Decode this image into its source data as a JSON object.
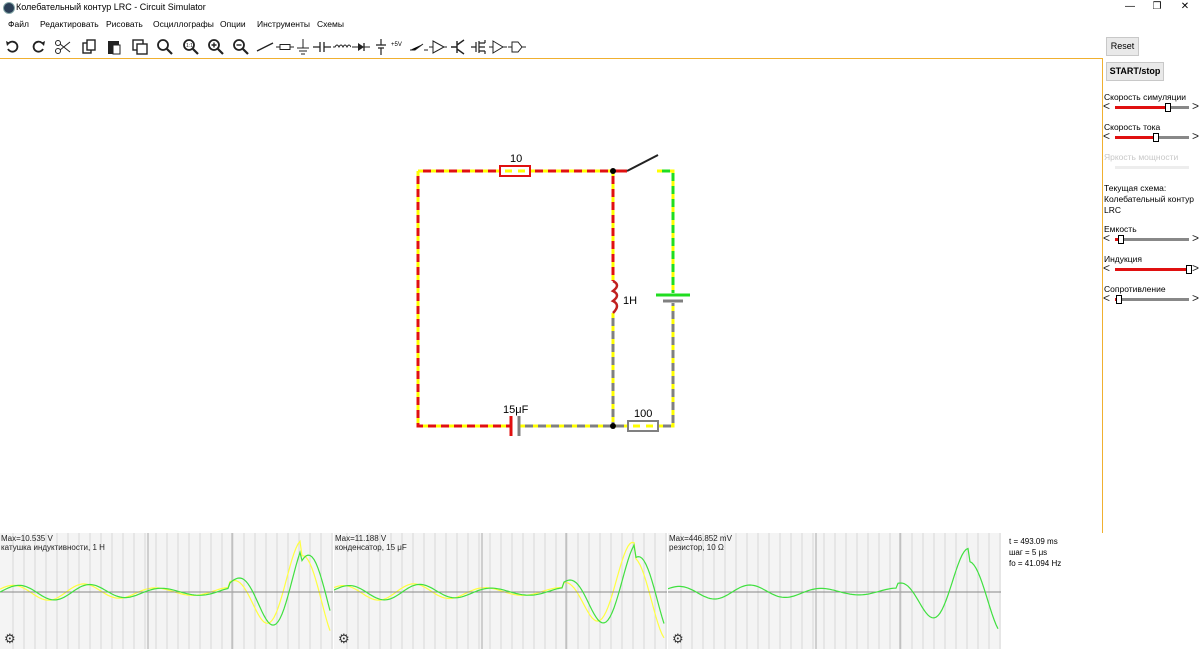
{
  "window": {
    "title": "Колебательный контур LRC - Circuit Simulator",
    "controls": [
      "—",
      "❐",
      "✕"
    ]
  },
  "menu": [
    "Файл",
    "Редактировать",
    "Рисовать",
    "Осциллографы",
    "Опции",
    "Инструменты",
    "Схемы"
  ],
  "toolbar": {
    "tools": [
      "undo-icon",
      "redo-icon",
      "cut-icon",
      "copy-icon",
      "paste-icon",
      "duplicate-icon",
      "zoom-search-icon",
      "zoom-fit-icon",
      "zoom-in-icon",
      "zoom-out-icon",
      "wire-icon",
      "resistor-icon",
      "ground-icon",
      "capacitor-icon",
      "inductor-icon",
      "diode-icon",
      "battery-icon",
      "voltage-5v-icon",
      "switch-icon",
      "opamp-icon",
      "transistor-icon",
      "mosfet-icon",
      "logic-gate-icon",
      "output-icon"
    ],
    "v5_label": "+5V"
  },
  "sidebar": {
    "reset_label": "Reset",
    "start_label": "START/stop",
    "sim_speed_label": "Скорость симуляции",
    "sim_speed_value": 0.72,
    "current_speed_label": "Скорость тока",
    "current_speed_value": 0.55,
    "power_brightness_label": "Яркость мощности",
    "power_brightness_value": 0.5,
    "current_circuit_label": "Текущая схема:",
    "current_circuit_name": "Колебательный контур LRC",
    "capacitance_label": "Емкость",
    "capacitance_value": 0.08,
    "inductance_label": "Индукция",
    "inductance_value": 1.0,
    "resistance_label": "Сопротивление",
    "resistance_value": 0.05
  },
  "circuit": {
    "r1_label": "10",
    "inductor_label": "1H",
    "capacitor_label": "15μF",
    "r2_label": "100"
  },
  "colors": {
    "current_dots": "#ffff00",
    "high_voltage": "#e01010",
    "positive_voltage": "#20dd20",
    "neutral_wire": "#808080",
    "canvas_border": "#f0b030"
  },
  "scopes": [
    {
      "max": "Max=10.535 V",
      "name": "катушка индуктивности, 1 H"
    },
    {
      "max": "Max=11.188 V",
      "name": "конденсатор, 15 μF"
    },
    {
      "max": "Max=446.852 mV",
      "name": "резистор, 10 Ω"
    }
  ],
  "info": {
    "time": "t = 493.09 ms",
    "step": "шаг = 5 μs",
    "freq": "fo = 41.094 Hz"
  }
}
